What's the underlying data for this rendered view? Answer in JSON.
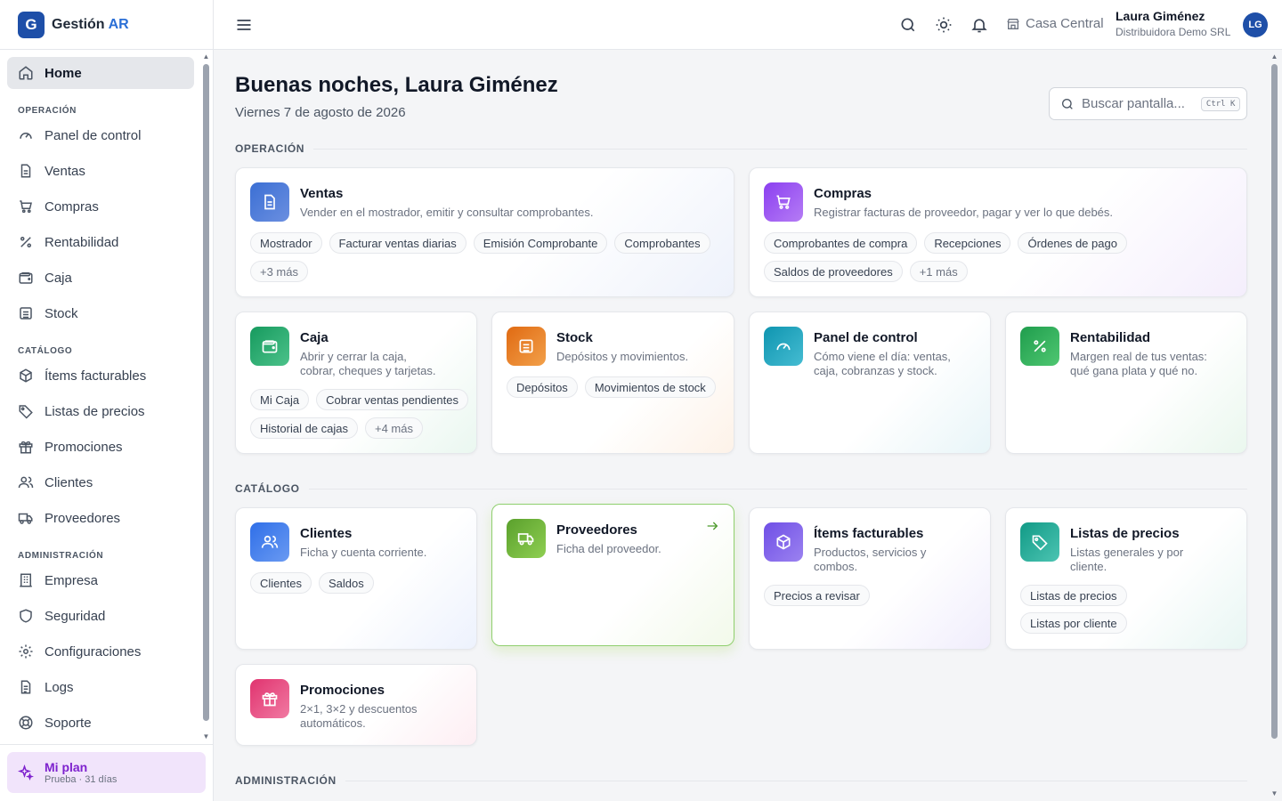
{
  "brand": {
    "logo_letter": "G",
    "name": "Gestión",
    "accent": "AR"
  },
  "sidebar": {
    "home": "Home",
    "sections": [
      {
        "label": "OPERACIÓN",
        "items": [
          "Panel de control",
          "Ventas",
          "Compras",
          "Rentabilidad",
          "Caja",
          "Stock"
        ]
      },
      {
        "label": "CATÁLOGO",
        "items": [
          "Ítems facturables",
          "Listas de precios",
          "Promociones",
          "Clientes",
          "Proveedores"
        ]
      },
      {
        "label": "ADMINISTRACIÓN",
        "items": [
          "Empresa",
          "Seguridad",
          "Configuraciones",
          "Logs",
          "Soporte"
        ]
      }
    ],
    "plan": {
      "title": "Mi plan",
      "subtitle": "Prueba · 31 días"
    }
  },
  "topbar": {
    "branch": "Casa Central",
    "user_name": "Laura Giménez",
    "user_company": "Distribuidora Demo SRL",
    "avatar_initials": "LG"
  },
  "main": {
    "greeting": "Buenas noches, Laura Giménez",
    "date": "Viernes 7 de agosto de 2026",
    "search_placeholder": "Buscar pantalla...",
    "search_shortcut": "Ctrl K",
    "section_operacion": "OPERACIÓN",
    "section_catalogo": "CATÁLOGO",
    "section_admin": "ADMINISTRACIÓN",
    "cards": {
      "ventas": {
        "title": "Ventas",
        "desc": "Vender en el mostrador, emitir y consultar comprobantes.",
        "chips": [
          "Mostrador",
          "Facturar ventas diarias",
          "Emisión Comprobante",
          "Comprobantes"
        ],
        "more": "+3 más"
      },
      "compras": {
        "title": "Compras",
        "desc": "Registrar facturas de proveedor, pagar y ver lo que debés.",
        "chips": [
          "Comprobantes de compra",
          "Recepciones",
          "Órdenes de pago",
          "Saldos de proveedores"
        ],
        "more": "+1 más"
      },
      "caja": {
        "title": "Caja",
        "desc1": "Abrir y cerrar la caja,",
        "desc2": "cobrar, cheques y tarjetas.",
        "chips": [
          "Mi Caja",
          "Cobrar ventas pendientes",
          "Historial de cajas"
        ],
        "more": "+4 más"
      },
      "stock": {
        "title": "Stock",
        "desc": "Depósitos y movimientos.",
        "chips": [
          "Depósitos",
          "Movimientos de stock"
        ]
      },
      "panel": {
        "title": "Panel de control",
        "desc1": "Cómo viene el día: ventas,",
        "desc2": "caja, cobranzas y stock."
      },
      "rentabilidad": {
        "title": "Rentabilidad",
        "desc1": "Margen real de tus ventas:",
        "desc2": "qué gana plata y qué no."
      },
      "clientes": {
        "title": "Clientes",
        "desc": "Ficha y cuenta corriente.",
        "chips": [
          "Clientes",
          "Saldos"
        ]
      },
      "proveedores": {
        "title": "Proveedores",
        "desc": "Ficha del proveedor."
      },
      "items": {
        "title": "Ítems facturables",
        "desc1": "Productos, servicios y",
        "desc2": "combos.",
        "chips": [
          "Precios a revisar"
        ]
      },
      "listas": {
        "title": "Listas de precios",
        "desc1": "Listas generales y por",
        "desc2": "cliente.",
        "chips": [
          "Listas de precios",
          "Listas por cliente"
        ]
      },
      "promociones": {
        "title": "Promociones",
        "desc1": "2×1, 3×2 y descuentos",
        "desc2": "automáticos."
      }
    }
  },
  "colors": {
    "brand": "#1e4fa8",
    "accent": "#2b6fd6",
    "plan": "#7e22ce",
    "highlight_border": "#8fcf6e"
  }
}
